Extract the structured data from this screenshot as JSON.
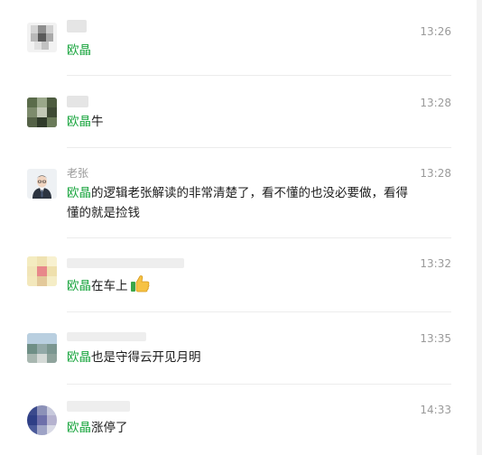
{
  "comments": [
    {
      "user": "",
      "time": "13:26",
      "mention": "欧晶",
      "text": "",
      "emoji": ""
    },
    {
      "user": "",
      "time": "13:28",
      "mention": "欧晶",
      "text": "牛",
      "emoji": ""
    },
    {
      "user": "老张",
      "time": "13:28",
      "mention": "欧晶",
      "text": "的逻辑老张解读的非常清楚了，看不懂的也没必要做，看得懂的就是捡钱",
      "emoji": ""
    },
    {
      "user": "",
      "time": "13:32",
      "mention": "欧晶",
      "text": "在车上",
      "emoji": "thumbs-up-icon"
    },
    {
      "user": "",
      "time": "13:35",
      "mention": "欧晶",
      "text": "也是守得云开见月明",
      "emoji": ""
    },
    {
      "user": "",
      "time": "14:33",
      "mention": "欧晶",
      "text": "涨停了",
      "emoji": ""
    }
  ],
  "colors": {
    "mention": "#17a43c",
    "meta": "#9a9a9a",
    "divider": "#ececec"
  }
}
